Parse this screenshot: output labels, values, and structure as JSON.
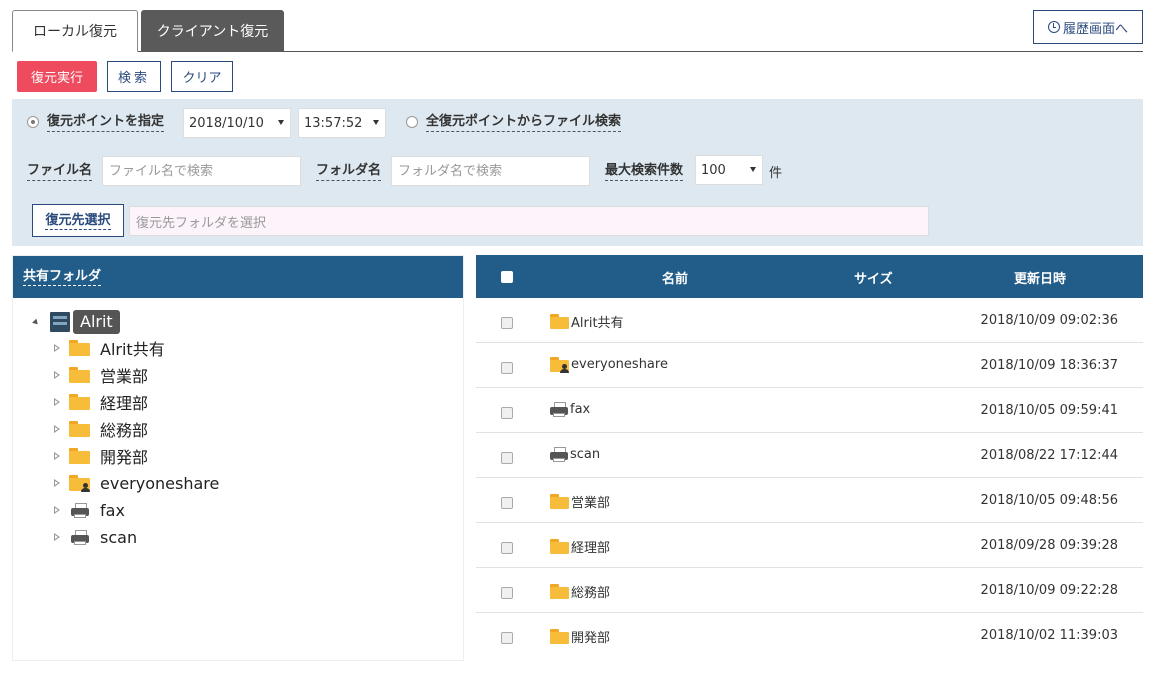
{
  "tabs": {
    "local": "ローカル復元",
    "client": "クライアント復元"
  },
  "history_button": "履歴画面へ",
  "actions": {
    "run": "復元実行",
    "search": "検索",
    "clear": "クリア"
  },
  "filter": {
    "restore_point_label": "復元ポイントを指定",
    "date": "2018/10/10",
    "time": "13:57:52",
    "all_points_label": "全復元ポイントからファイル検索",
    "file_name_label": "ファイル名",
    "file_name_placeholder": "ファイル名で検索",
    "folder_name_label": "フォルダ名",
    "folder_name_placeholder": "フォルダ名で検索",
    "max_results_label": "最大検索件数",
    "max_results": "100",
    "unit": "件",
    "destination_button": "復元先選択",
    "destination_placeholder": "復元先フォルダを選択"
  },
  "tree": {
    "header": "共有フォルダ",
    "root": "Alrit",
    "children": [
      {
        "label": "Alrit共有",
        "icon": "folder-icon"
      },
      {
        "label": "営業部",
        "icon": "folder-icon"
      },
      {
        "label": "経理部",
        "icon": "folder-icon"
      },
      {
        "label": "総務部",
        "icon": "folder-icon"
      },
      {
        "label": "開発部",
        "icon": "folder-icon"
      },
      {
        "label": "everyoneshare",
        "icon": "shared-folder-icon"
      },
      {
        "label": "fax",
        "icon": "printer-icon"
      },
      {
        "label": "scan",
        "icon": "printer-icon"
      }
    ]
  },
  "table": {
    "columns": {
      "name": "名前",
      "size": "サイズ",
      "updated": "更新日時"
    },
    "rows": [
      {
        "name": "Alrit共有",
        "icon": "folder-icon",
        "size": "",
        "updated": "2018/10/09 09:02:36"
      },
      {
        "name": "everyoneshare",
        "icon": "shared-folder-icon",
        "size": "",
        "updated": "2018/10/09 18:36:37"
      },
      {
        "name": "fax",
        "icon": "printer-icon",
        "size": "",
        "updated": "2018/10/05 09:59:41"
      },
      {
        "name": "scan",
        "icon": "printer-icon",
        "size": "",
        "updated": "2018/08/22 17:12:44"
      },
      {
        "name": "営業部",
        "icon": "folder-icon",
        "size": "",
        "updated": "2018/10/05 09:48:56"
      },
      {
        "name": "経理部",
        "icon": "folder-icon",
        "size": "",
        "updated": "2018/09/28 09:39:28"
      },
      {
        "name": "総務部",
        "icon": "folder-icon",
        "size": "",
        "updated": "2018/10/09 09:22:28"
      },
      {
        "name": "開発部",
        "icon": "folder-icon",
        "size": "",
        "updated": "2018/10/02 11:39:03"
      }
    ]
  },
  "colors": {
    "header_blue": "#215d88",
    "run_red": "#ee4b5e",
    "filter_bg": "#dde8f0",
    "accent_navy": "#2a4a7c"
  }
}
